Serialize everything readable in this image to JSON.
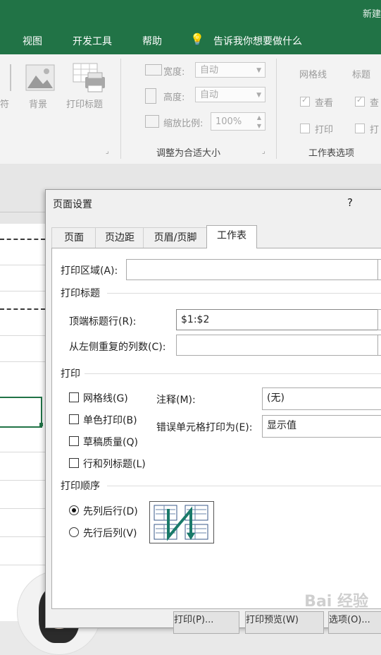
{
  "window": {
    "title": "新建"
  },
  "ribbon_tabs": [
    "视图",
    "开发工具",
    "帮助"
  ],
  "tell_me": "告诉我你想要做什么",
  "ribbon": {
    "page_setup": {
      "labels": [
        "符",
        "背景",
        "打印标题"
      ]
    },
    "scale": {
      "width_label": "宽度:",
      "width_value": "自动",
      "height_label": "高度:",
      "height_value": "自动",
      "scale_label": "缩放比例:",
      "scale_value": "100%",
      "group_label": "调整为合适大小"
    },
    "sheet_options": {
      "gridlines": "网格线",
      "headings": "标题",
      "view": "查看",
      "view2": "查",
      "print": "打印",
      "print2": "打",
      "group_label": "工作表选项"
    }
  },
  "dialog": {
    "title": "页面设置",
    "help": "?",
    "tabs": [
      "页面",
      "页边距",
      "页眉/页脚",
      "工作表"
    ],
    "active_tab": "工作表",
    "print_area_label": "打印区域(A):",
    "print_area_value": "",
    "print_titles_header": "打印标题",
    "rows_repeat_label": "顶端标题行(R):",
    "rows_repeat_value": "$1:$2",
    "cols_repeat_label": "从左侧重复的列数(C):",
    "cols_repeat_value": "",
    "print_header": "打印",
    "checkboxes": [
      "网格线(G)",
      "单色打印(B)",
      "草稿质量(Q)",
      "行和列标题(L)"
    ],
    "comments_label": "注释(M):",
    "comments_value": "(无)",
    "errors_label": "错误单元格打印为(E):",
    "errors_value": "显示值",
    "order_header": "打印顺序",
    "order_options": [
      "先列后行(D)",
      "先行后列(V)"
    ],
    "selected_order": "先列后行(D)",
    "buttons": [
      "打印(P)...",
      "打印预览(W)",
      "选项(O)..."
    ]
  },
  "watermark": "Bai 经验"
}
